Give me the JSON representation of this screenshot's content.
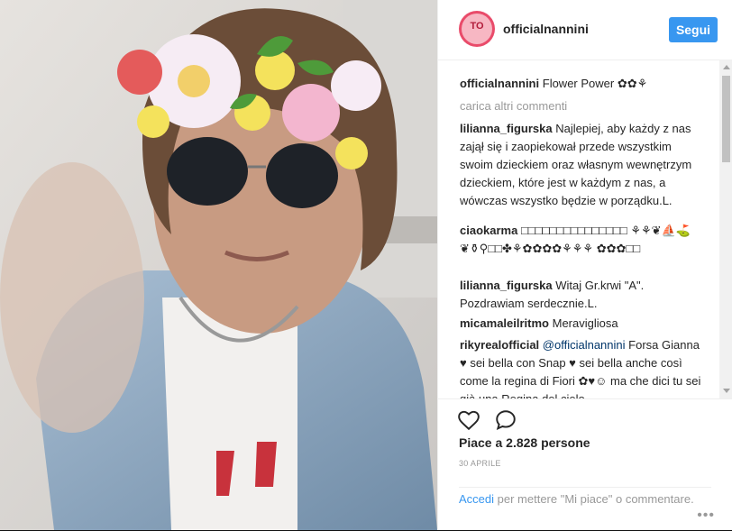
{
  "post": {
    "username": "officialnannini",
    "follow_label": "Segui",
    "caption_user": "officialnannini",
    "caption_text": "Flower Power ✿✿⚘",
    "load_more": "carica altri commenti",
    "comments": [
      {
        "user": "lilianna_figurska",
        "text": "Najlepiej, aby każdy z nas zajął się i zaopiekował przede wszystkim swoim dzieckiem oraz własnym wewnętrzym dzieckiem, które jest w każdym z nas, a wówczas wszystko będzie w porządku.L."
      },
      {
        "user": "ciaokarma",
        "text": "□□□□□□□□□□□□□□□ ⚘⚘❦⛵⛳❦⚱⚲□□✤⚘✿✿✿✿⚘⚘⚘ ✿✿✿□□"
      },
      {
        "user": "lilianna_figurska",
        "text": "Witaj Gr.krwi \"A\". Pozdrawiam serdecznie.L."
      },
      {
        "user": "micamaleilritmo",
        "text": "Meravigliosa"
      },
      {
        "user": "rikyrealofficial",
        "mention": "@officialnannini",
        "text": "Forsa Gianna ♥ sei bella con Snap ♥ sei bella anche così come la regina di Fiori ✿♥☺ ma che dici tu sei già una Regina del cielo"
      }
    ],
    "likes_text": "Piace a 2.828 persone",
    "date": "30 APRILE",
    "login_link": "Accedi",
    "login_text": " per mettere \"Mi piace\" o commentare.",
    "more_dots": "•••"
  },
  "icons": {
    "heart": "heart-icon",
    "comment": "comment-icon"
  },
  "colors": {
    "accent": "#3897f0",
    "text": "#262626",
    "muted": "#999999"
  }
}
